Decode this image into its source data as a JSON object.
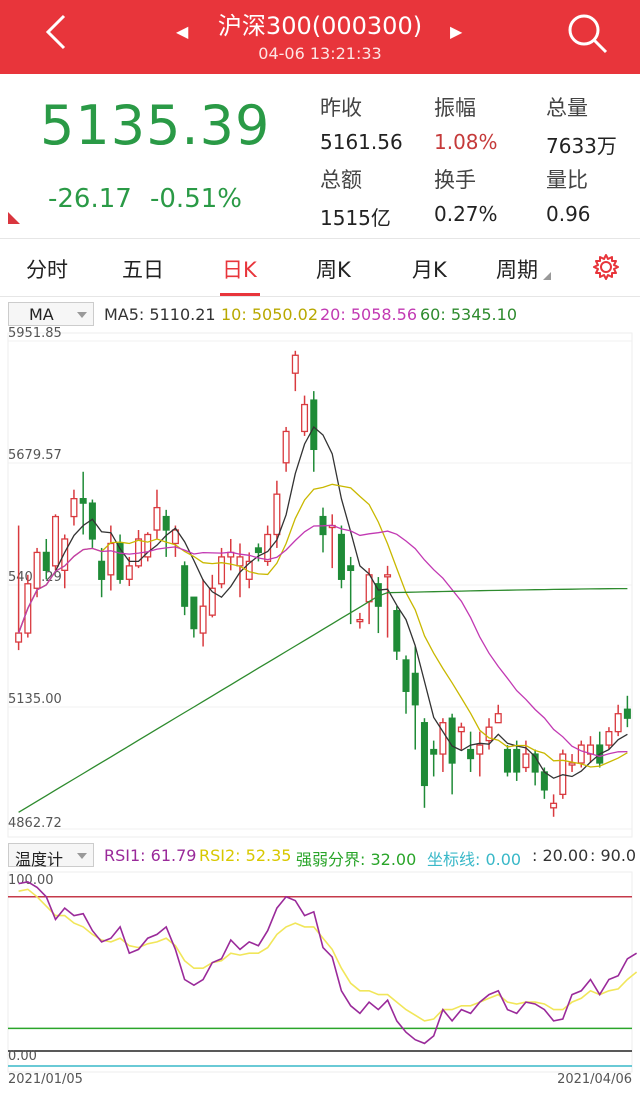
{
  "header": {
    "title": "沪深300(000300)",
    "time": "04-06 13:21:33"
  },
  "quote": {
    "price": "5135.39",
    "change": "-26.17",
    "change_pct": "-0.51%",
    "stats": [
      {
        "label": "昨收",
        "value": "5161.56",
        "color": "#222222"
      },
      {
        "label": "振幅",
        "value": "1.08%",
        "color": "#c53a3a"
      },
      {
        "label": "总量",
        "value": "7633万",
        "color": "#222222"
      },
      {
        "label": "总额",
        "value": "1515亿",
        "color": "#222222"
      },
      {
        "label": "换手",
        "value": "0.27%",
        "color": "#222222"
      },
      {
        "label": "量比",
        "value": "0.96",
        "color": "#222222"
      }
    ]
  },
  "tabs": [
    "分时",
    "五日",
    "日K",
    "周K",
    "月K",
    "周期"
  ],
  "active_tab": "日K",
  "ma": {
    "selector": "MA",
    "items": [
      {
        "text": "MA5: 5110.21",
        "color": "#333333"
      },
      {
        "text": "10: 5050.02",
        "color": "#b8a800"
      },
      {
        "text": "20: 5058.56",
        "color": "#c239b3"
      },
      {
        "text": "60: 5345.10",
        "color": "#2e8b2e"
      }
    ]
  },
  "rsi": {
    "selector": "温度计",
    "items": [
      {
        "text": "RSI1: 61.79",
        "color": "#9a2a9a"
      },
      {
        "text": "RSI2: 52.35",
        "color": "#d8c800"
      },
      {
        "text": "强弱分界: 32.00",
        "color": "#2aa52a"
      },
      {
        "text": "坐标线: 0.00",
        "color": "#39b8c8"
      },
      {
        "text": ": 20.00",
        "color": "#333333"
      },
      {
        "text": ": 90.0",
        "color": "#333333"
      }
    ]
  },
  "chart_data": {
    "type": "candlestick",
    "price_axis": {
      "labels": [
        "5951.85",
        "5679.57",
        "5407.29",
        "5135.00",
        "4862.72"
      ],
      "ylim": [
        4862.72,
        5951.85
      ]
    },
    "rsi_axis": {
      "labels": [
        "100.00",
        "0.00"
      ],
      "ylim": [
        0,
        100
      ]
    },
    "date_labels": [
      "2021/01/05",
      "2021/04/06"
    ],
    "candles": [
      [
        5280,
        5300,
        5540,
        5262
      ],
      [
        5300,
        5410,
        5430,
        5290
      ],
      [
        5400,
        5480,
        5490,
        5380
      ],
      [
        5480,
        5440,
        5510,
        5420
      ],
      [
        5450,
        5560,
        5565,
        5440
      ],
      [
        5440,
        5510,
        5520,
        5400
      ],
      [
        5560,
        5600,
        5620,
        5540
      ],
      [
        5600,
        5590,
        5660,
        5520
      ],
      [
        5590,
        5510,
        5598,
        5490
      ],
      [
        5460,
        5420,
        5490,
        5380
      ],
      [
        5430,
        5500,
        5540,
        5395
      ],
      [
        5500,
        5420,
        5520,
        5410
      ],
      [
        5420,
        5450,
        5470,
        5405
      ],
      [
        5450,
        5510,
        5530,
        5445
      ],
      [
        5470,
        5520,
        5525,
        5460
      ],
      [
        5530,
        5580,
        5620,
        5510
      ],
      [
        5560,
        5530,
        5575,
        5470
      ],
      [
        5500,
        5530,
        5540,
        5470
      ],
      [
        5450,
        5360,
        5460,
        5340
      ],
      [
        5380,
        5310,
        5380,
        5290
      ],
      [
        5300,
        5360,
        5420,
        5270
      ],
      [
        5340,
        5400,
        5430,
        5335
      ],
      [
        5410,
        5470,
        5490,
        5400
      ],
      [
        5470,
        5480,
        5510,
        5440
      ],
      [
        5450,
        5470,
        5500,
        5380
      ],
      [
        5420,
        5460,
        5480,
        5400
      ],
      [
        5490,
        5480,
        5500,
        5460
      ],
      [
        5460,
        5520,
        5540,
        5450
      ],
      [
        5520,
        5610,
        5640,
        5490
      ],
      [
        5680,
        5750,
        5760,
        5660
      ],
      [
        5880,
        5920,
        5930,
        5840
      ],
      [
        5750,
        5810,
        5830,
        5740
      ],
      [
        5820,
        5710,
        5840,
        5660
      ],
      [
        5560,
        5520,
        5580,
        5480
      ],
      [
        5540,
        5540,
        5565,
        5445
      ],
      [
        5520,
        5420,
        5540,
        5400
      ],
      [
        5450,
        5440,
        5470,
        5320
      ],
      [
        5330,
        5330,
        5345,
        5310
      ],
      [
        5370,
        5430,
        5445,
        5320
      ],
      [
        5410,
        5360,
        5425,
        5300
      ],
      [
        5430,
        5430,
        5450,
        5290
      ],
      [
        5350,
        5260,
        5360,
        5240
      ],
      [
        5240,
        5170,
        5250,
        5120
      ],
      [
        5210,
        5140,
        5270,
        5040
      ],
      [
        5100,
        4960,
        5110,
        4910
      ],
      [
        5040,
        5030,
        5060,
        4980
      ],
      [
        5030,
        5100,
        5110,
        4990
      ],
      [
        5110,
        5010,
        5120,
        4940
      ],
      [
        5080,
        5090,
        5100,
        5040
      ],
      [
        5040,
        5020,
        5080,
        4990
      ],
      [
        5030,
        5050,
        5080,
        4980
      ],
      [
        5060,
        5090,
        5110,
        5040
      ],
      [
        5100,
        5120,
        5140,
        5100
      ],
      [
        5040,
        4990,
        5050,
        4980
      ],
      [
        5040,
        4990,
        5060,
        4970
      ],
      [
        5000,
        5030,
        5060,
        4990
      ],
      [
        5030,
        4990,
        5040,
        4960
      ],
      [
        4990,
        4950,
        5000,
        4930
      ],
      [
        4910,
        4920,
        4940,
        4890
      ],
      [
        4940,
        5030,
        5040,
        4930
      ],
      [
        5010,
        5010,
        5030,
        4990
      ],
      [
        5010,
        5050,
        5060,
        5000
      ],
      [
        5030,
        5050,
        5070,
        5010
      ],
      [
        5050,
        5010,
        5080,
        5000
      ],
      [
        5050,
        5080,
        5090,
        5040
      ],
      [
        5080,
        5120,
        5140,
        5070
      ],
      [
        5130,
        5110,
        5160,
        5090
      ]
    ],
    "rsi1": [
      97,
      98,
      95,
      90,
      78,
      84,
      80,
      81,
      72,
      66,
      68,
      74,
      60,
      62,
      68,
      70,
      74,
      62,
      46,
      43,
      46,
      55,
      57,
      67,
      62,
      66,
      64,
      72,
      84,
      90,
      88,
      80,
      82,
      63,
      58,
      40,
      32,
      28,
      34,
      30,
      35,
      24,
      18,
      14,
      12,
      16,
      30,
      24,
      30,
      28,
      34,
      38,
      40,
      30,
      28,
      34,
      33,
      30,
      24,
      25,
      38,
      40,
      46,
      38,
      46,
      48,
      57,
      60
    ],
    "rsi2": [
      93,
      94,
      90,
      85,
      80,
      80,
      76,
      74,
      70,
      67,
      66,
      68,
      64,
      63,
      65,
      66,
      68,
      64,
      56,
      52,
      52,
      55,
      56,
      60,
      59,
      60,
      60,
      63,
      70,
      74,
      76,
      74,
      74,
      68,
      62,
      52,
      44,
      40,
      40,
      38,
      38,
      34,
      30,
      27,
      24,
      25,
      30,
      30,
      32,
      32,
      34,
      36,
      38,
      34,
      33,
      34,
      34,
      33,
      30,
      30,
      34,
      36,
      40,
      38,
      40,
      41,
      46,
      50
    ],
    "rsi_levels": {
      "upper": 90,
      "strong_weak": 20,
      "lower": 8
    }
  }
}
